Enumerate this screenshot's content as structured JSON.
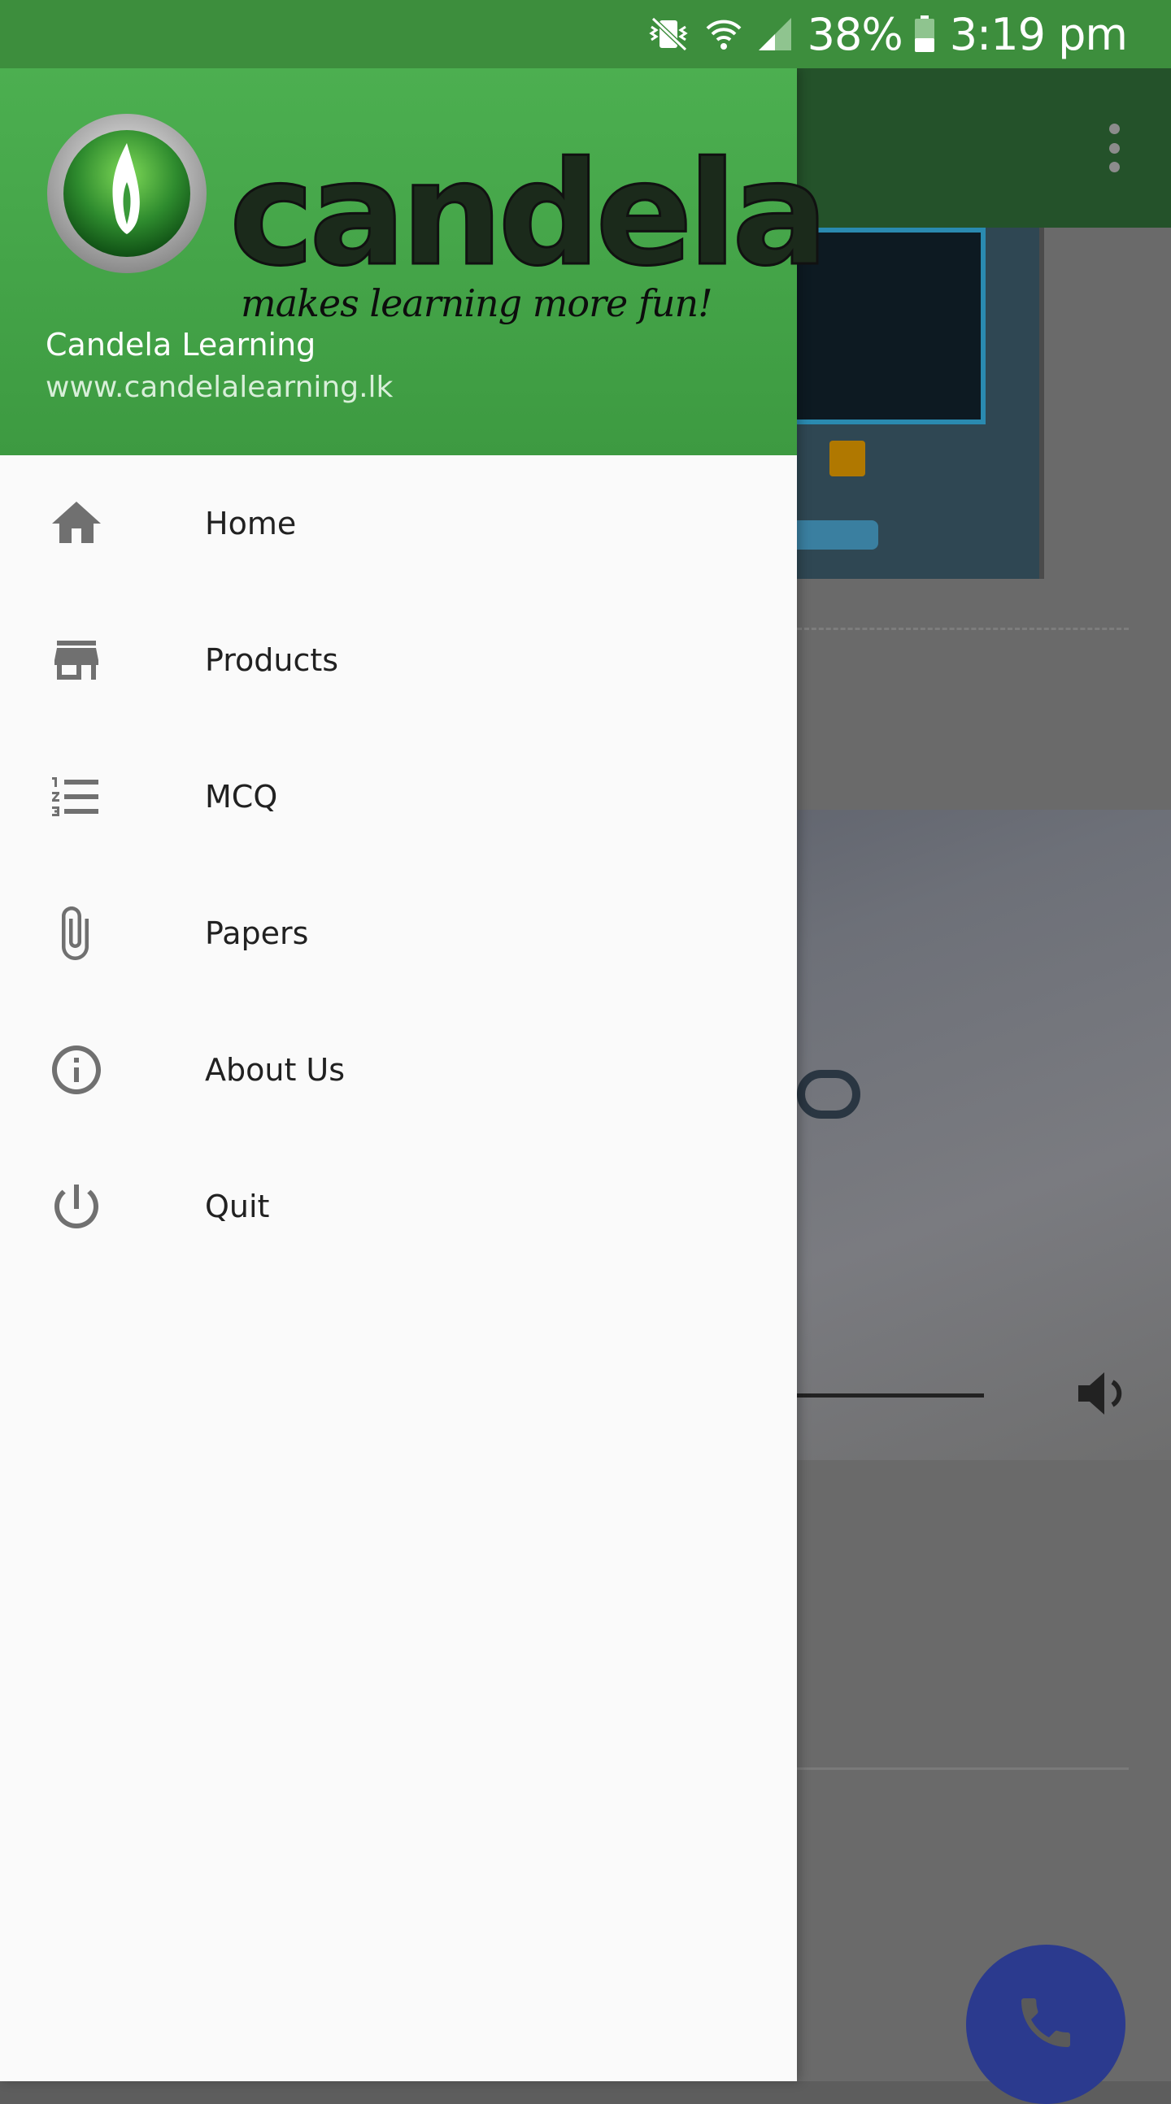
{
  "status_bar": {
    "battery_percent": "38%",
    "time": "3:19 pm",
    "icons": [
      "vibrate-icon",
      "wifi-icon",
      "signal-icon",
      "battery-icon"
    ]
  },
  "drawer": {
    "header": {
      "logo_text": "candela",
      "tagline": "makes learning more fun!",
      "name": "Candela Learning",
      "url": "www.candelalearning.lk",
      "background_color": "#4caf50"
    },
    "items": [
      {
        "label": "Home",
        "icon": "home-icon"
      },
      {
        "label": "Products",
        "icon": "store-icon"
      },
      {
        "label": "MCQ",
        "icon": "numbered-list-icon"
      },
      {
        "label": "Papers",
        "icon": "paperclip-icon"
      },
      {
        "label": "About Us",
        "icon": "info-icon"
      },
      {
        "label": "Quit",
        "icon": "power-icon"
      }
    ]
  },
  "colors": {
    "status_bar": "#3d8e3d",
    "drawer_bg": "#fafafa",
    "fab": "#2b3a8e"
  }
}
